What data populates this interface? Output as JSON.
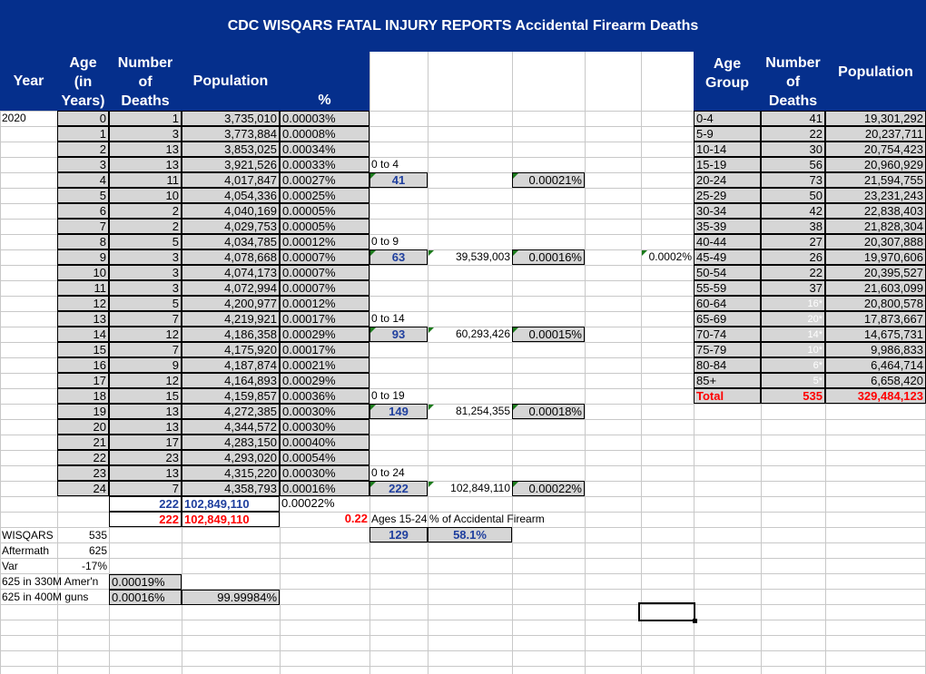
{
  "title": "CDC WISQARS FATAL INJURY REPORTS Accidental Firearm Deaths",
  "left_headers": {
    "year": "Year",
    "age": [
      "Age",
      "(in",
      "Years)"
    ],
    "number": [
      "Number",
      "of",
      "Deaths"
    ],
    "population": "Population",
    "percent": "%"
  },
  "right_headers": {
    "age_group": [
      "Age",
      "Group"
    ],
    "number": [
      "Number",
      "of",
      "Deaths"
    ],
    "population": "Population"
  },
  "year_value": "2020",
  "rows": [
    {
      "age": "0",
      "deaths": "1",
      "pop": "3,735,010",
      "pct": "0.00003%"
    },
    {
      "age": "1",
      "deaths": "3",
      "pop": "3,773,884",
      "pct": "0.00008%"
    },
    {
      "age": "2",
      "deaths": "13",
      "pop": "3,853,025",
      "pct": "0.00034%"
    },
    {
      "age": "3",
      "deaths": "13",
      "pop": "3,921,526",
      "pct": "0.00033%"
    },
    {
      "age": "4",
      "deaths": "11",
      "pop": "4,017,847",
      "pct": "0.00027%"
    },
    {
      "age": "5",
      "deaths": "10",
      "pop": "4,054,336",
      "pct": "0.00025%"
    },
    {
      "age": "6",
      "deaths": "2",
      "pop": "4,040,169",
      "pct": "0.00005%"
    },
    {
      "age": "7",
      "deaths": "2",
      "pop": "4,029,753",
      "pct": "0.00005%"
    },
    {
      "age": "8",
      "deaths": "5",
      "pop": "4,034,785",
      "pct": "0.00012%"
    },
    {
      "age": "9",
      "deaths": "3",
      "pop": "4,078,668",
      "pct": "0.00007%"
    },
    {
      "age": "10",
      "deaths": "3",
      "pop": "4,074,173",
      "pct": "0.00007%"
    },
    {
      "age": "11",
      "deaths": "3",
      "pop": "4,072,994",
      "pct": "0.00007%"
    },
    {
      "age": "12",
      "deaths": "5",
      "pop": "4,200,977",
      "pct": "0.00012%"
    },
    {
      "age": "13",
      "deaths": "7",
      "pop": "4,219,921",
      "pct": "0.00017%"
    },
    {
      "age": "14",
      "deaths": "12",
      "pop": "4,186,358",
      "pct": "0.00029%"
    },
    {
      "age": "15",
      "deaths": "7",
      "pop": "4,175,920",
      "pct": "0.00017%"
    },
    {
      "age": "16",
      "deaths": "9",
      "pop": "4,187,874",
      "pct": "0.00021%"
    },
    {
      "age": "17",
      "deaths": "12",
      "pop": "4,164,893",
      "pct": "0.00029%"
    },
    {
      "age": "18",
      "deaths": "15",
      "pop": "4,159,857",
      "pct": "0.00036%"
    },
    {
      "age": "19",
      "deaths": "13",
      "pop": "4,272,385",
      "pct": "0.00030%"
    },
    {
      "age": "20",
      "deaths": "13",
      "pop": "4,344,572",
      "pct": "0.00030%"
    },
    {
      "age": "21",
      "deaths": "17",
      "pop": "4,283,150",
      "pct": "0.00040%"
    },
    {
      "age": "22",
      "deaths": "23",
      "pop": "4,293,020",
      "pct": "0.00054%"
    },
    {
      "age": "23",
      "deaths": "13",
      "pop": "4,315,220",
      "pct": "0.00030%"
    },
    {
      "age": "24",
      "deaths": "7",
      "pop": "4,358,793",
      "pct": "0.00016%"
    }
  ],
  "subtotal_blue": {
    "deaths": "222",
    "pop": "102,849,110",
    "pct": "0.00022%"
  },
  "subtotal_red": {
    "deaths": "222",
    "pop": "102,849,110",
    "ratio": "0.22"
  },
  "groups": [
    {
      "label": "0 to 4",
      "deaths": "41",
      "pop": "",
      "pct": "0.00021%"
    },
    {
      "label": "0 to 9",
      "deaths": "63",
      "pop": "39,539,003",
      "pct": "0.00016%"
    },
    {
      "label": "0 to 14",
      "deaths": "93",
      "pop": "60,293,426",
      "pct": "0.00015%"
    },
    {
      "label": "0 to 19",
      "deaths": "149",
      "pop": "81,254,355",
      "pct": "0.00018%"
    },
    {
      "label": "0 to 24",
      "deaths": "222",
      "pop": "102,849,110",
      "pct": "0.00022%"
    }
  ],
  "ages_15_24": {
    "label": "Ages 15-24",
    "pct_label": "% of Accidental Firearm",
    "deaths": "129",
    "share": "58.1%"
  },
  "side_pct": "0.0002%",
  "right_rows": [
    {
      "group": "0-4",
      "deaths": "41",
      "pop": "19,301,292"
    },
    {
      "group": "5-9",
      "deaths": "22",
      "pop": "20,237,711"
    },
    {
      "group": "10-14",
      "deaths": "30",
      "pop": "20,754,423"
    },
    {
      "group": "15-19",
      "deaths": "56",
      "pop": "20,960,929"
    },
    {
      "group": "20-24",
      "deaths": "73",
      "pop": "21,594,755"
    },
    {
      "group": "25-29",
      "deaths": "50",
      "pop": "23,231,243"
    },
    {
      "group": "30-34",
      "deaths": "42",
      "pop": "22,838,403"
    },
    {
      "group": "35-39",
      "deaths": "38",
      "pop": "21,828,304"
    },
    {
      "group": "40-44",
      "deaths": "27",
      "pop": "20,307,888"
    },
    {
      "group": "45-49",
      "deaths": "26",
      "pop": "19,970,606"
    },
    {
      "group": "50-54",
      "deaths": "22",
      "pop": "20,395,527"
    },
    {
      "group": "55-59",
      "deaths": "37",
      "pop": "21,603,099"
    },
    {
      "group": "60-64",
      "deaths": "16*",
      "pop": "20,800,578"
    },
    {
      "group": "65-69",
      "deaths": "20*",
      "pop": "17,873,667"
    },
    {
      "group": "70-74",
      "deaths": "14*",
      "pop": "14,675,731"
    },
    {
      "group": "75-79",
      "deaths": "10*",
      "pop": "9,986,833"
    },
    {
      "group": "80-84",
      "deaths": "6*",
      "pop": "6,464,714"
    },
    {
      "group": "85+",
      "deaths": "5*",
      "pop": "6,658,420"
    }
  ],
  "right_total": {
    "label": "Total",
    "deaths": "535",
    "pop": "329,484,123"
  },
  "bottom": {
    "wisqars_label": "WISQARS",
    "wisqars_val": "535",
    "aftermath_label": "Aftermath",
    "aftermath_val": "625",
    "var_label": "Var",
    "var_val": "-17%",
    "amer_label": "625 in 330M Amer'n",
    "amer_val": "0.00019%",
    "guns_label": "625 in 400M guns",
    "guns_val": "0.00016%",
    "guns_rest": "99.99984%"
  }
}
